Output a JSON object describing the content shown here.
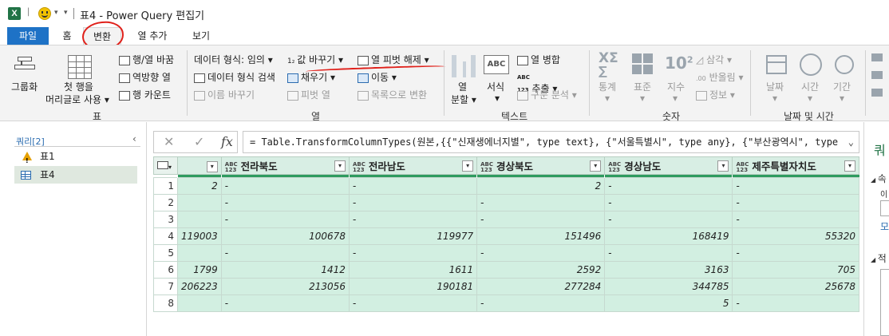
{
  "titlebar": {
    "app_logo": "X",
    "title": "표4 - Power Query 편집기"
  },
  "tabs": [
    "파일",
    "홈",
    "변환",
    "열 추가",
    "보기"
  ],
  "ribbon": {
    "table_group": {
      "label": "표",
      "group_by": "그룹화",
      "use_first_row": "첫 행을",
      "use_first_row_2": "머리글로 사용",
      "transpose": "행/열 바꿈",
      "reverse_rows": "역방향 열",
      "count_rows": "행 카운트"
    },
    "any_column_group": {
      "label": "열",
      "data_type": "데이터 형식: 임의",
      "detect_type": "데이터 형식 검색",
      "rename": "이름 바꾸기",
      "replace_values": "값 바꾸기",
      "fill": "채우기",
      "pivot": "피벗 열",
      "unpivot": "열 피벗 해제",
      "move": "이동",
      "to_list": "목록으로 변환"
    },
    "text_group": {
      "label": "텍스트",
      "split": "열",
      "split_2": "분할",
      "format": "서식",
      "merge": "열 병합",
      "extract": "추출",
      "parse": "구문 분석"
    },
    "number_group": {
      "label": "숫자",
      "statistics": "통계",
      "standard": "표준",
      "scientific": "지수",
      "trig": "삼각",
      "rounding": "반올림",
      "information": "정보"
    },
    "datetime_group": {
      "label": "날짜 및 시간",
      "date": "날짜",
      "time": "시간",
      "duration": "기간"
    }
  },
  "query_pane": {
    "title": "쿼리[2]",
    "items": [
      "표1",
      "표4"
    ]
  },
  "formula_bar": {
    "fx": "fx",
    "formula": "= Table.TransformColumnTypes(원본,{{\"신재생에너지별\", type text}, {\"서울특별시\", type any}, {\"부산광역시\", type"
  },
  "grid": {
    "columns": [
      "",
      "전라북도",
      "전라남도",
      "경상북도",
      "경상남도",
      "제주특별자치도"
    ],
    "type_badge": "ABC 123",
    "rows": [
      [
        "2",
        "-",
        "-",
        "2",
        "-",
        "-"
      ],
      [
        "",
        "-",
        "-",
        "-",
        "-",
        "-"
      ],
      [
        "",
        "-",
        "-",
        "-",
        "-",
        "-"
      ],
      [
        "119003",
        "100678",
        "119977",
        "151496",
        "168419",
        "55320"
      ],
      [
        "",
        "-",
        "-",
        "-",
        "-",
        "-"
      ],
      [
        "1799",
        "1412",
        "1611",
        "2592",
        "3163",
        "705"
      ],
      [
        "206223",
        "213056",
        "190181",
        "277284",
        "344785",
        "25678"
      ],
      [
        "",
        "-",
        "-",
        "-",
        "5",
        "-"
      ]
    ]
  },
  "right_pane": {
    "title": "쿼",
    "props": "속",
    "name_short": "이",
    "all": "모",
    "steps": "적"
  },
  "colors": {
    "file_tab": "#1e72c6",
    "annotation_red": "#e0201a",
    "grid_cell": "#d2efe1",
    "quality_bar": "#2e9b5f"
  }
}
